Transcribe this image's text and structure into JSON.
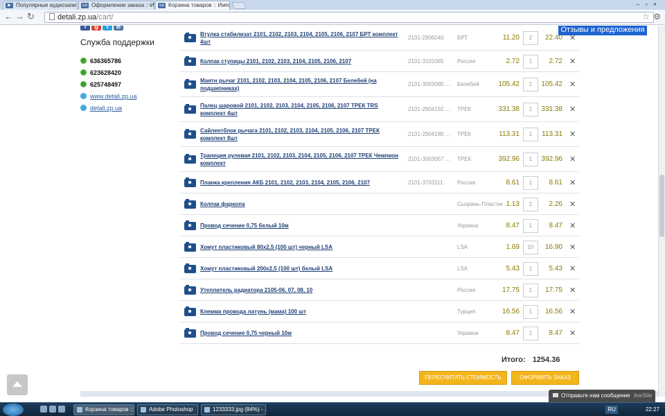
{
  "browser": {
    "tabs": [
      {
        "title": "Популярные аудиозапи",
        "favicon": "audio-tab-icon"
      },
      {
        "title": "Оформление заказа :: Инте",
        "favicon": "ua-site-tab-icon"
      },
      {
        "title": "Корзина товаров :: Интер",
        "favicon": "ua-site-tab-icon"
      }
    ],
    "url_host": "detali.zp.ua",
    "url_path": "/cart/"
  },
  "sidebar": {
    "support_title": "Служба поддержки",
    "contacts": [
      {
        "type": "icq",
        "value": "636365786"
      },
      {
        "type": "icq",
        "value": "623628420"
      },
      {
        "type": "icq",
        "value": "625748497"
      },
      {
        "type": "skype",
        "value": "www.detali.zp.ua"
      },
      {
        "type": "skype",
        "value": "detali.zp.ua"
      }
    ]
  },
  "feedback_button": "Отзывы и предложения",
  "cart": {
    "rows": [
      {
        "name": "Втулка стабилизат 2101, 2102, 2103, 2104, 2105, 2106, 2107 БРТ комплект 4шт",
        "article": "2101-2906040",
        "brand": "БРТ",
        "price": "11.20",
        "qty": "2",
        "sum": "22.40"
      },
      {
        "name": "Колпак ступицы 2101, 2102, 2103, 2104, 2105, 2106, 2107",
        "article": "2101-3101065",
        "brand": "Россия",
        "price": "2.72",
        "qty": "1",
        "sum": "2.72"
      },
      {
        "name": "Маятн рычаг 2101, 2102, 2103, 2104, 2105, 2106, 2107 Белебей (на подшипниках)",
        "article": "2101-3003080 ...",
        "brand": "Белебей",
        "price": "105.42",
        "qty": "1",
        "sum": "105.42"
      },
      {
        "name": "Палец шаровой 2101, 2102, 2103, 2104, 2105, 2106, 2107 ТРЕК TRS комплект 4шт",
        "article": "2101-2904192 ...",
        "brand": "ТРЕК",
        "price": "331.38",
        "qty": "1",
        "sum": "331.38"
      },
      {
        "name": "Сайлентблок рычага 2101, 2102, 2103, 2104, 2105, 2106, 2107 ТРЕК комплект 8шт",
        "article": "2101-2904180 ...",
        "brand": "ТРЕК",
        "price": "113.31",
        "qty": "1",
        "sum": "113.31"
      },
      {
        "name": "Трапеция рулевая 2101, 2102, 2103, 2104, 2105, 2106, 2107 ТРЕК Чемпион комплект",
        "article": "2101-3003057 ...",
        "brand": "ТРЕК",
        "price": "392.96",
        "qty": "1",
        "sum": "392.96"
      },
      {
        "name": "Планка крепления АКБ 2101, 2102, 2103, 2104, 2105, 2106, 2107",
        "article": "2101-3703111",
        "brand": "Россия",
        "price": "8.61",
        "qty": "1",
        "sum": "8.61"
      },
      {
        "name": "Колпак фаркопа",
        "article": "",
        "brand": "Сызрань-Пластик",
        "price": "1.13",
        "qty": "2",
        "sum": "2.26"
      },
      {
        "name": "Провод сечение 0,75 белый 10м",
        "article": "",
        "brand": "Украина",
        "price": "8.47",
        "qty": "1",
        "sum": "8.47"
      },
      {
        "name": "Хомут пластиковый 80х2,5 (100 шт) черный LSA",
        "article": "",
        "brand": "LSA",
        "price": "1.69",
        "qty": "10",
        "sum": "16.90"
      },
      {
        "name": "Хомут пластиковый 200х2,5 (100 шт) белый LSA",
        "article": "",
        "brand": "LSA",
        "price": "5.43",
        "qty": "1",
        "sum": "5.43"
      },
      {
        "name": "Утеплитель радиатора 2105-06, 07, 08, 10",
        "article": "",
        "brand": "Россия",
        "price": "17.75",
        "qty": "1",
        "sum": "17.75"
      },
      {
        "name": "Клемма провода латунь (мама) 100 шт",
        "article": "",
        "brand": "Турция",
        "price": "16.56",
        "qty": "1",
        "sum": "16.56"
      },
      {
        "name": "Провод сечение 0,75 черный 10м",
        "article": "",
        "brand": "Украина",
        "price": "8.47",
        "qty": "1",
        "sum": "8.47"
      }
    ],
    "delete_glyph": "✕",
    "total_label": "Итого:",
    "total_value": "1254.36",
    "recalc_button": "ПЕРЕСЧИТАТЬ СТОИМОСТЬ",
    "order_button": "ОФОРМИТЬ ЗАКАЗ"
  },
  "livesite": {
    "message": "Отправьте нам сообщение",
    "brand": "liveSite"
  },
  "taskbar": {
    "items": [
      {
        "label": "Корзина товаров :: ...",
        "active": true
      },
      {
        "label": "Adobe Photoshop",
        "active": false
      },
      {
        "label": "1233333.jpg (84%) - ...",
        "active": false
      }
    ],
    "language": "RU",
    "clock": "22:27"
  },
  "colors": {
    "accent_blue": "#1e63d2",
    "price_gold": "#8a7a00",
    "button_orange": "#f3b51c",
    "link_navy": "#1f3f77"
  }
}
